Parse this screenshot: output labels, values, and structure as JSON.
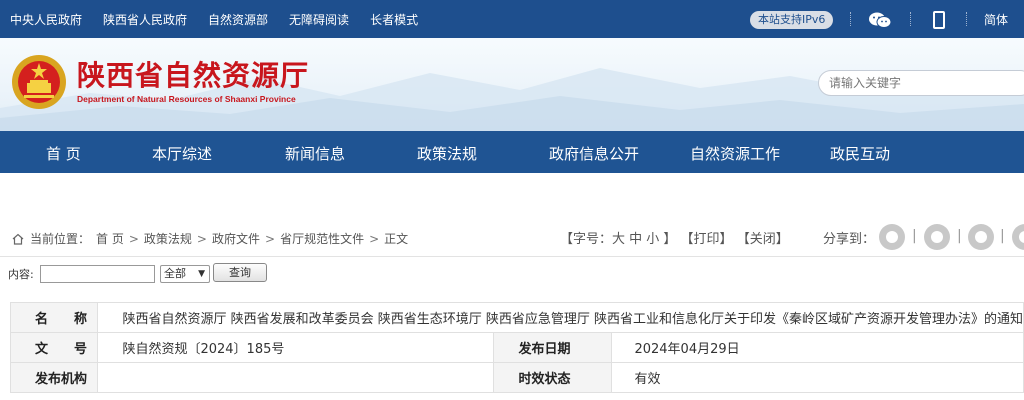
{
  "topbar": {
    "links": [
      "中央人民政府",
      "陕西省人民政府",
      "自然资源部",
      "无障碍阅读",
      "长者模式"
    ],
    "ipv6_badge": "本站支持IPv6",
    "lang": "简体"
  },
  "banner": {
    "title": "陕西省自然资源厅",
    "subtitle": "Department of Natural Resources of Shaanxi Province",
    "search_placeholder": "请输入关键字"
  },
  "nav": [
    "首 页",
    "本厅综述",
    "新闻信息",
    "政策法规",
    "政府信息公开",
    "自然资源工作",
    "政民互动"
  ],
  "breadcrumb": {
    "prefix": "当前位置：",
    "items": [
      "首 页",
      "政策法规",
      "政府文件",
      "省厅规范性文件",
      "正文"
    ],
    "sep": ">"
  },
  "tools": {
    "font_size": "【字号：大 中 小 】",
    "print": "【打印】",
    "close": "【关闭】",
    "share_label": "分享到：",
    "share_icons": [
      "wechat-share-icon",
      "weibo-share-icon",
      "qq-share-icon",
      "qzone-share-icon"
    ]
  },
  "query": {
    "label": "内容:",
    "select_value": "全部",
    "button": "查询"
  },
  "doc": {
    "name_label": "名　　称",
    "name_value": "陕西省自然资源厅 陕西省发展和改革委员会 陕西省生态环境厅 陕西省应急管理厅 陕西省工业和信息化厅关于印发《秦岭区域矿产资源开发管理办法》的通知",
    "number_label": "文　　号",
    "number_value": "陕自然资规〔2024〕185号",
    "date_label": "发布日期",
    "date_value": "2024年04月29日",
    "org_label": "发布机构",
    "org_value": "",
    "status_label": "时效状态",
    "status_value": "有效"
  },
  "colors": {
    "topbar": "#1e4f8e",
    "nav": "#1f5493",
    "title_red": "#c8161d"
  }
}
